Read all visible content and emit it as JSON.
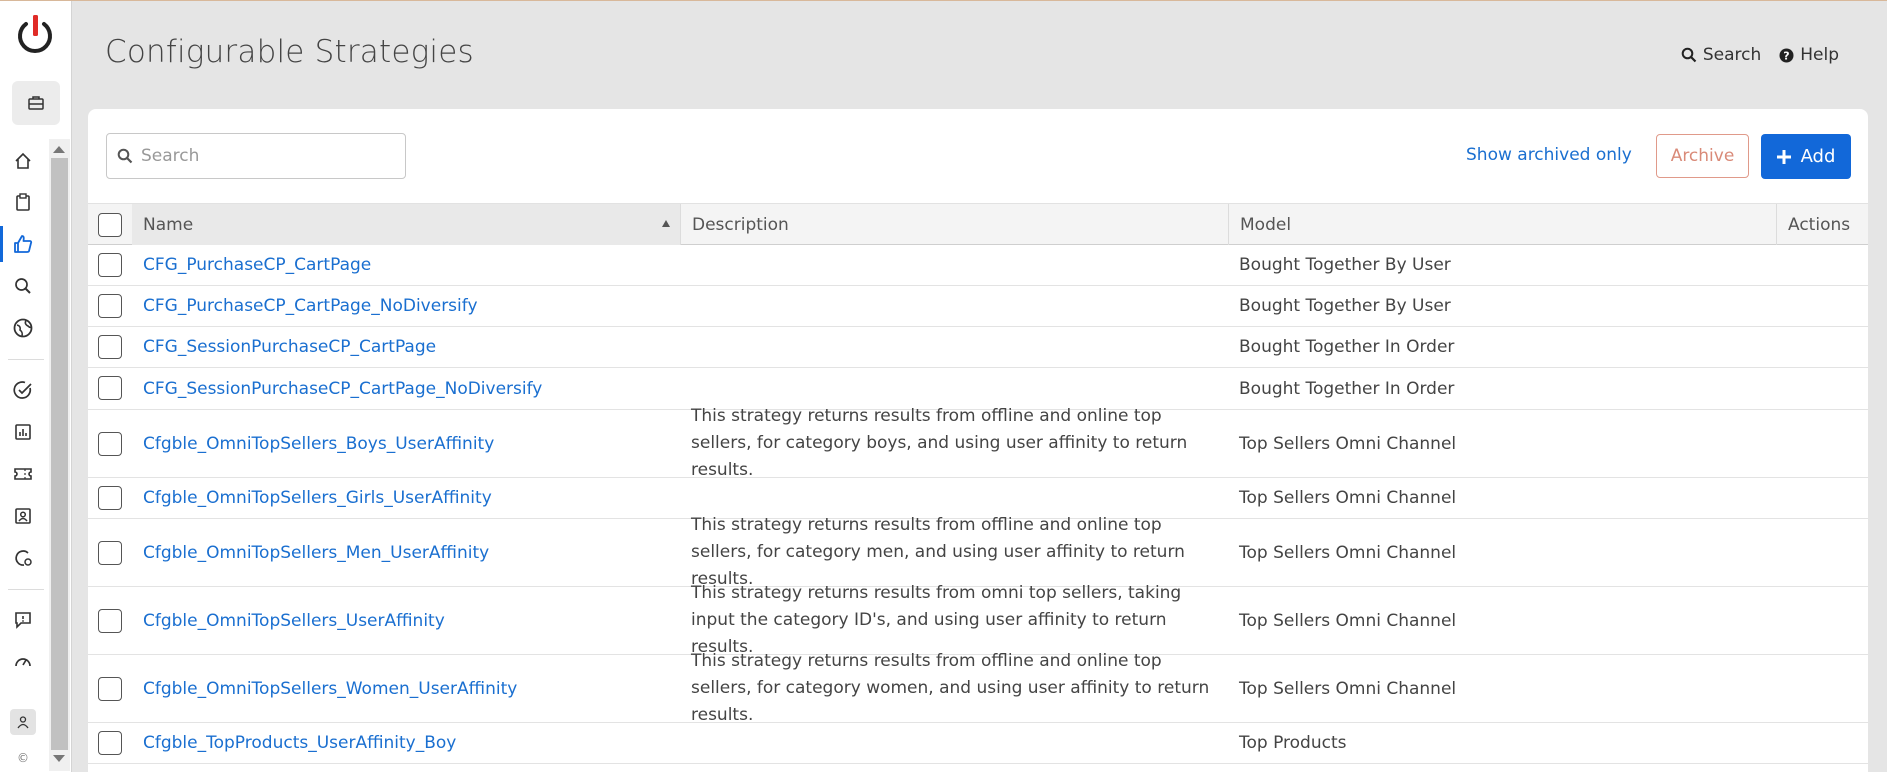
{
  "header": {
    "title": "Configurable Strategies",
    "search_label": "Search",
    "help_label": "Help"
  },
  "toolbar": {
    "search_placeholder": "Search",
    "show_archived_label": "Show archived only",
    "archive_label": "Archive",
    "add_label": "Add"
  },
  "table": {
    "columns": [
      "Name",
      "Description",
      "Model",
      "Actions"
    ],
    "rows": [
      {
        "name": "CFG_PurchaseCP_CartPage",
        "description": "",
        "model": "Bought Together By User"
      },
      {
        "name": "CFG_PurchaseCP_CartPage_NoDiversify",
        "description": "",
        "model": "Bought Together By User"
      },
      {
        "name": "CFG_SessionPurchaseCP_CartPage",
        "description": "",
        "model": "Bought Together In Order"
      },
      {
        "name": "CFG_SessionPurchaseCP_CartPage_NoDiversify",
        "description": "",
        "model": "Bought Together In Order"
      },
      {
        "name": "Cfgble_OmniTopSellers_Boys_UserAffinity",
        "description": "This strategy returns results from offline and online top sellers, for category boys, and using user affinity to return results.",
        "model": "Top Sellers Omni Channel"
      },
      {
        "name": "Cfgble_OmniTopSellers_Girls_UserAffinity",
        "description": "",
        "model": "Top Sellers Omni Channel"
      },
      {
        "name": "Cfgble_OmniTopSellers_Men_UserAffinity",
        "description": "This strategy returns results from offline and online top sellers, for category men, and using user affinity to return results.",
        "model": "Top Sellers Omni Channel"
      },
      {
        "name": "Cfgble_OmniTopSellers_UserAffinity",
        "description": "This strategy returns results from omni top sellers, taking input the category ID's, and using user affinity to return results.",
        "model": "Top Sellers Omni Channel"
      },
      {
        "name": "Cfgble_OmniTopSellers_Women_UserAffinity",
        "description": "This strategy returns results from offline and online top sellers, for category women, and using user affinity to return results.",
        "model": "Top Sellers Omni Channel"
      },
      {
        "name": "Cfgble_TopProducts_UserAffinity_Boy",
        "description": "",
        "model": "Top Products"
      }
    ]
  },
  "sidebar": {
    "copyright": "©",
    "items": [
      "home-icon",
      "clipboard-icon",
      "thumbs-up-icon",
      "search-icon",
      "globe-icon",
      "check-badge-icon",
      "report-icon",
      "ticket-icon",
      "contact-card-icon",
      "settings-shield-icon",
      "feedback-icon",
      "dashboard-icon",
      "user-icon"
    ]
  },
  "colors": {
    "accent": "#1268d9",
    "link": "#1a6fd0",
    "archive": "#d98a78",
    "logo_red": "#e02b27"
  }
}
